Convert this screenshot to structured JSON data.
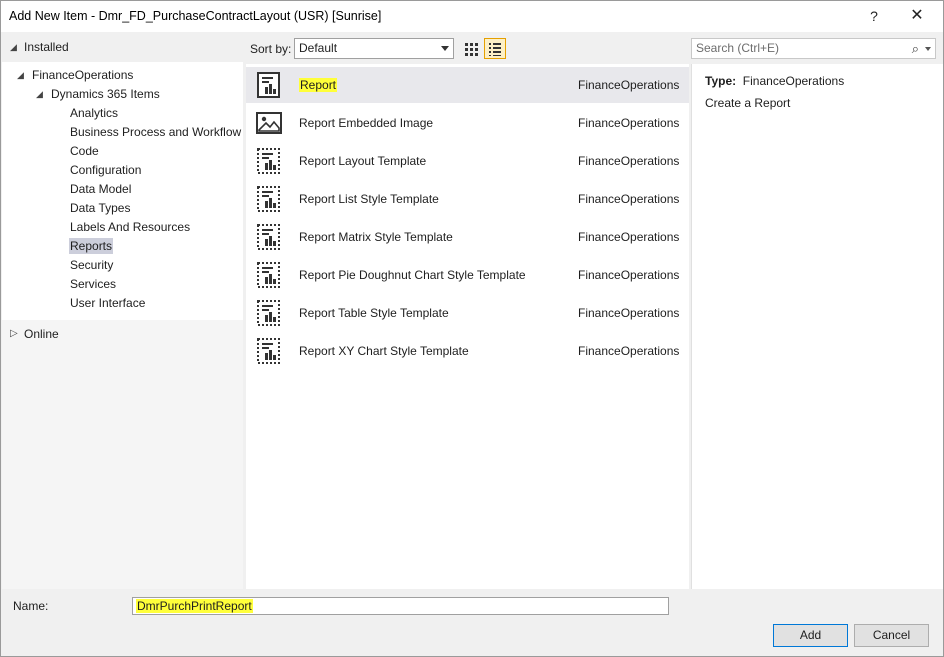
{
  "window": {
    "title": "Add New Item - Dmr_FD_PurchaseContractLayout (USR) [Sunrise]",
    "help_label": "?",
    "close_label": "✕"
  },
  "tree": {
    "installed": "Installed",
    "finance_operations": "FinanceOperations",
    "dynamics_items": "Dynamics 365 Items",
    "items": [
      "Analytics",
      "Business Process and Workflow",
      "Code",
      "Configuration",
      "Data Model",
      "Data Types",
      "Labels And Resources",
      "Reports",
      "Security",
      "Services",
      "User Interface"
    ],
    "selected": "Reports",
    "online": "Online"
  },
  "toolbar": {
    "sort_label": "Sort by:",
    "sort_value": "Default"
  },
  "search": {
    "placeholder": "Search (Ctrl+E)"
  },
  "templates": [
    {
      "name": "Report",
      "category": "FinanceOperations",
      "icon": "report-icon"
    },
    {
      "name": "Report Embedded Image",
      "category": "FinanceOperations",
      "icon": "image-icon"
    },
    {
      "name": "Report Layout Template",
      "category": "FinanceOperations",
      "icon": "report-template-icon"
    },
    {
      "name": "Report List Style Template",
      "category": "FinanceOperations",
      "icon": "report-template-icon"
    },
    {
      "name": "Report Matrix Style Template",
      "category": "FinanceOperations",
      "icon": "report-template-icon"
    },
    {
      "name": "Report Pie Doughnut Chart Style Template",
      "category": "FinanceOperations",
      "icon": "report-template-icon"
    },
    {
      "name": "Report Table Style Template",
      "category": "FinanceOperations",
      "icon": "report-template-icon"
    },
    {
      "name": "Report XY Chart Style Template",
      "category": "FinanceOperations",
      "icon": "report-template-icon"
    }
  ],
  "details": {
    "type_label": "Type:",
    "type_value": "FinanceOperations",
    "description": "Create a Report"
  },
  "footer": {
    "name_label": "Name:",
    "name_value": "DmrPurchPrintReport",
    "add_label": "Add",
    "cancel_label": "Cancel"
  },
  "colors": {
    "highlight": "#ffff3a",
    "selected_row": "#e8e8ec",
    "selected_tree": "#cccedb",
    "accent": "#0078d7"
  }
}
